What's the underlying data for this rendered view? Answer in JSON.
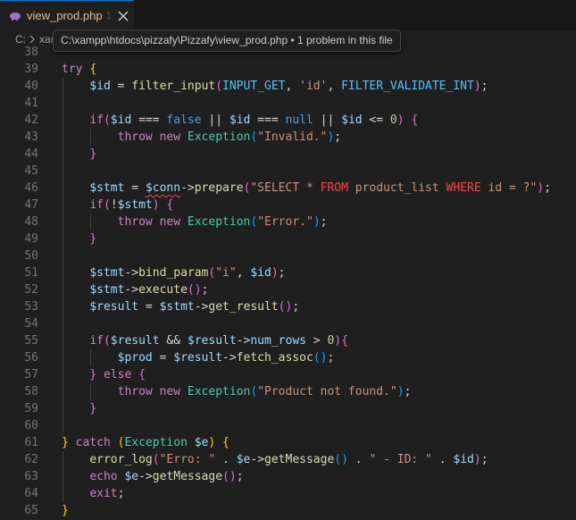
{
  "tab": {
    "filename": "view_prod.php",
    "dirty_marker": "1"
  },
  "breadcrumb": {
    "drive": "C:",
    "part": "xar"
  },
  "tooltip": {
    "text": "C:\\xampp\\htdocs\\pizzafy\\Pizzafy\\view_prod.php • 1 problem in this file"
  },
  "colors": {
    "accent": "#0078d4",
    "php_icon": "#a074c4",
    "error_squiggle": "#f14c4c"
  },
  "icons": {
    "tab_file": "php-elephant-icon",
    "tab_close": "close-icon",
    "breadcrumb_sep": "chevron-right-icon"
  },
  "editor": {
    "lines": [
      {
        "n": "38",
        "tokens": []
      },
      {
        "n": "39",
        "tokens": [
          [
            "try",
            "kw"
          ],
          [
            " "
          ],
          [
            "{",
            "b1"
          ]
        ]
      },
      {
        "n": "40",
        "tokens": [
          [
            "    "
          ],
          [
            "$id",
            "var"
          ],
          [
            " = "
          ],
          [
            "filter_input",
            "fn"
          ],
          [
            "(",
            "b2"
          ],
          [
            "INPUT_GET",
            "const"
          ],
          [
            ", "
          ],
          [
            "'id'",
            "str"
          ],
          [
            ", "
          ],
          [
            "FILTER_VALIDATE_INT",
            "const"
          ],
          [
            ")",
            "b2"
          ],
          [
            ";"
          ]
        ]
      },
      {
        "n": "41",
        "tokens": []
      },
      {
        "n": "42",
        "tokens": [
          [
            "    "
          ],
          [
            "if",
            "kw"
          ],
          [
            "(",
            "b2"
          ],
          [
            "$id",
            "var"
          ],
          [
            " === "
          ],
          [
            "false",
            "bool"
          ],
          [
            " || "
          ],
          [
            "$id",
            "var"
          ],
          [
            " === "
          ],
          [
            "null",
            "bool"
          ],
          [
            " || "
          ],
          [
            "$id",
            "var"
          ],
          [
            " <= "
          ],
          [
            "0",
            "num"
          ],
          [
            ")",
            "b2"
          ],
          [
            " "
          ],
          [
            "{",
            "b2"
          ]
        ]
      },
      {
        "n": "43",
        "tokens": [
          [
            "        "
          ],
          [
            "throw",
            "kw"
          ],
          [
            " "
          ],
          [
            "new",
            "kw"
          ],
          [
            " "
          ],
          [
            "Exception",
            "class"
          ],
          [
            "(",
            "b3"
          ],
          [
            "\"Invalid.\"",
            "str"
          ],
          [
            ")",
            "b3"
          ],
          [
            ";"
          ]
        ]
      },
      {
        "n": "44",
        "tokens": [
          [
            "    "
          ],
          [
            "}",
            "b2"
          ]
        ]
      },
      {
        "n": "45",
        "tokens": []
      },
      {
        "n": "46",
        "tokens": [
          [
            "    "
          ],
          [
            "$stmt",
            "var"
          ],
          [
            " = "
          ],
          [
            "$conn",
            "var",
            "squig"
          ],
          [
            "->"
          ],
          [
            "prepare",
            "fn"
          ],
          [
            "(",
            "b2"
          ],
          [
            "\"SELECT * ",
            "str"
          ],
          [
            "FROM",
            "sql"
          ],
          [
            " product_list ",
            "str"
          ],
          [
            "WHERE",
            "sql"
          ],
          [
            " id = ?\"",
            "str"
          ],
          [
            ")",
            "b2"
          ],
          [
            ";"
          ]
        ]
      },
      {
        "n": "47",
        "tokens": [
          [
            "    "
          ],
          [
            "if",
            "kw"
          ],
          [
            "(",
            "b2"
          ],
          [
            "!"
          ],
          [
            "$stmt",
            "var"
          ],
          [
            ")",
            "b2"
          ],
          [
            " "
          ],
          [
            "{",
            "b2"
          ]
        ]
      },
      {
        "n": "48",
        "tokens": [
          [
            "        "
          ],
          [
            "throw",
            "kw"
          ],
          [
            " "
          ],
          [
            "new",
            "kw"
          ],
          [
            " "
          ],
          [
            "Exception",
            "class"
          ],
          [
            "(",
            "b3"
          ],
          [
            "\"Error.\"",
            "str"
          ],
          [
            ")",
            "b3"
          ],
          [
            ";"
          ]
        ]
      },
      {
        "n": "49",
        "tokens": [
          [
            "    "
          ],
          [
            "}",
            "b2"
          ]
        ]
      },
      {
        "n": "50",
        "tokens": []
      },
      {
        "n": "51",
        "tokens": [
          [
            "    "
          ],
          [
            "$stmt",
            "var"
          ],
          [
            "->"
          ],
          [
            "bind_param",
            "fn"
          ],
          [
            "(",
            "b2"
          ],
          [
            "\"i\"",
            "str"
          ],
          [
            ", "
          ],
          [
            "$id",
            "var"
          ],
          [
            ")",
            "b2"
          ],
          [
            ";"
          ]
        ]
      },
      {
        "n": "52",
        "tokens": [
          [
            "    "
          ],
          [
            "$stmt",
            "var"
          ],
          [
            "->"
          ],
          [
            "execute",
            "fn"
          ],
          [
            "(",
            "b2"
          ],
          [
            ")",
            "b2"
          ],
          [
            ";"
          ]
        ]
      },
      {
        "n": "53",
        "tokens": [
          [
            "    "
          ],
          [
            "$result",
            "var"
          ],
          [
            " = "
          ],
          [
            "$stmt",
            "var"
          ],
          [
            "->"
          ],
          [
            "get_result",
            "fn"
          ],
          [
            "(",
            "b2"
          ],
          [
            ")",
            "b2"
          ],
          [
            ";"
          ]
        ]
      },
      {
        "n": "54",
        "tokens": []
      },
      {
        "n": "55",
        "tokens": [
          [
            "    "
          ],
          [
            "if",
            "kw"
          ],
          [
            "(",
            "b2"
          ],
          [
            "$result",
            "var"
          ],
          [
            " && "
          ],
          [
            "$result",
            "var"
          ],
          [
            "->"
          ],
          [
            "num_rows",
            "var"
          ],
          [
            " > "
          ],
          [
            "0",
            "num"
          ],
          [
            ")",
            "b2"
          ],
          [
            "{",
            "b2"
          ]
        ]
      },
      {
        "n": "56",
        "tokens": [
          [
            "        "
          ],
          [
            "$prod",
            "var"
          ],
          [
            " = "
          ],
          [
            "$result",
            "var"
          ],
          [
            "->"
          ],
          [
            "fetch_assoc",
            "fn"
          ],
          [
            "(",
            "b3"
          ],
          [
            ")",
            "b3"
          ],
          [
            ";"
          ]
        ]
      },
      {
        "n": "57",
        "tokens": [
          [
            "    "
          ],
          [
            "}",
            "b2"
          ],
          [
            " "
          ],
          [
            "else",
            "kw"
          ],
          [
            " "
          ],
          [
            "{",
            "b2"
          ]
        ]
      },
      {
        "n": "58",
        "tokens": [
          [
            "        "
          ],
          [
            "throw",
            "kw"
          ],
          [
            " "
          ],
          [
            "new",
            "kw"
          ],
          [
            " "
          ],
          [
            "Exception",
            "class"
          ],
          [
            "(",
            "b3"
          ],
          [
            "\"Product not found.\"",
            "str"
          ],
          [
            ")",
            "b3"
          ],
          [
            ";"
          ]
        ]
      },
      {
        "n": "59",
        "tokens": [
          [
            "    "
          ],
          [
            "}",
            "b2"
          ]
        ]
      },
      {
        "n": "60",
        "tokens": []
      },
      {
        "n": "61",
        "tokens": [
          [
            "}",
            "b1"
          ],
          [
            " "
          ],
          [
            "catch",
            "kw"
          ],
          [
            " "
          ],
          [
            "(",
            "b1"
          ],
          [
            "Exception",
            "class"
          ],
          [
            " "
          ],
          [
            "$e",
            "var"
          ],
          [
            ")",
            "b1"
          ],
          [
            " "
          ],
          [
            "{",
            "b1"
          ]
        ]
      },
      {
        "n": "62",
        "tokens": [
          [
            "    "
          ],
          [
            "error_log",
            "fn"
          ],
          [
            "(",
            "b2"
          ],
          [
            "\"Erro: \"",
            "str"
          ],
          [
            " . "
          ],
          [
            "$e",
            "var"
          ],
          [
            "->"
          ],
          [
            "getMessage",
            "fn"
          ],
          [
            "(",
            "b3"
          ],
          [
            ")",
            "b3"
          ],
          [
            " . "
          ],
          [
            "\" - ID: \"",
            "str"
          ],
          [
            " . "
          ],
          [
            "$id",
            "var"
          ],
          [
            ")",
            "b2"
          ],
          [
            ";"
          ]
        ]
      },
      {
        "n": "63",
        "tokens": [
          [
            "    "
          ],
          [
            "echo",
            "kw"
          ],
          [
            " "
          ],
          [
            "$e",
            "var"
          ],
          [
            "->"
          ],
          [
            "getMessage",
            "fn"
          ],
          [
            "(",
            "b2"
          ],
          [
            ")",
            "b2"
          ],
          [
            ";"
          ]
        ]
      },
      {
        "n": "64",
        "tokens": [
          [
            "    "
          ],
          [
            "exit",
            "kw"
          ],
          [
            ";"
          ]
        ]
      },
      {
        "n": "65",
        "tokens": [
          [
            "}",
            "b1"
          ]
        ]
      }
    ]
  }
}
